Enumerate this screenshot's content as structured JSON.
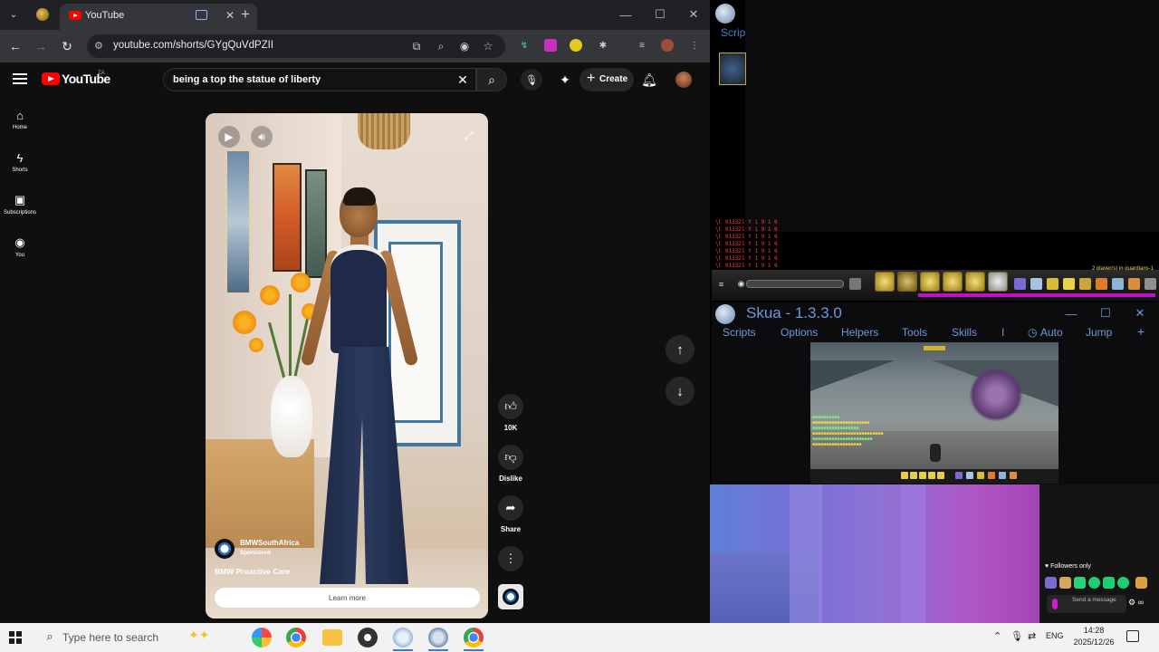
{
  "browser": {
    "tab_title": "YouTube",
    "url": "youtube.com/shorts/GYgQuVdPZII"
  },
  "youtube": {
    "wordmark": "YouTube",
    "region": "ZA",
    "search_query": "being a top the statue of liberty",
    "create_label": "Create",
    "guide": [
      {
        "label": "Home",
        "icon": "home-icon"
      },
      {
        "label": "Shorts",
        "icon": "shorts-icon"
      },
      {
        "label": "Subscriptions",
        "icon": "subscriptions-icon"
      },
      {
        "label": "You",
        "icon": "you-icon"
      }
    ],
    "short": {
      "channel": "BMWSouthAfrica",
      "sponsored": "Sponsored",
      "ad_title": "BMW Proactive Care",
      "cta": "Learn more"
    },
    "actions": {
      "like_count": "10K",
      "dislike_label": "Dislike",
      "share_label": "Share"
    }
  },
  "game_top": {
    "scripts_label": "Scrip",
    "players_label": "2 player(s) in guardians-1",
    "chat_lines": [
      "\\C 913321 Y 1 9 1 8",
      "\\C 913321 Y 1 9 1 8",
      "\\C 913321 Y 1 9 1 8",
      "\\C 913321 Y 1 9 1 8",
      "\\C 913321 Y 1 9 1 8",
      "\\C 913321 Y 1 9 1 8",
      "\\C 913321 Y 1 9 1 8"
    ]
  },
  "skua": {
    "title": "Skua - 1.3.3.0",
    "menu": [
      "Scripts",
      "Options",
      "Helpers",
      "Tools",
      "Skills",
      "I",
      "Auto",
      "Jump",
      "+"
    ]
  },
  "stream_chat": {
    "followers_only": "Followers only",
    "send_placeholder": "Send a message"
  },
  "taskbar": {
    "search_placeholder": "Type here to search",
    "language": "ENG",
    "time": "14:28",
    "date": "2025/12/26"
  },
  "colors": {
    "youtube_red": "#ff0000",
    "skua_blue": "#6d9ad8",
    "xp_bar": "#c010c9",
    "taskbar_bg": "#f2f2f2"
  }
}
